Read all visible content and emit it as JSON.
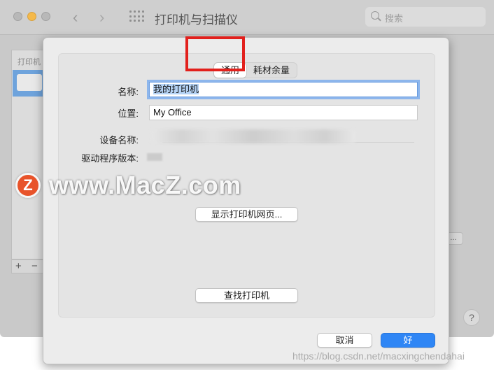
{
  "window": {
    "title": "打印机与扫描仪",
    "search_placeholder": "搜索"
  },
  "background": {
    "list_header": "打印机",
    "add_label": "+",
    "remove_label": "−",
    "options_button": "...",
    "help_label": "?"
  },
  "sheet": {
    "tabs": [
      {
        "label": "通用",
        "active": true
      },
      {
        "label": "耗材余量",
        "active": false
      }
    ],
    "fields": {
      "name_label": "名称:",
      "name_value": "我的打印机",
      "location_label": "位置:",
      "location_value": "My Office",
      "device_name_label": "设备名称:",
      "driver_version_label": "驱动程序版本:"
    },
    "buttons": {
      "show_webpage": "显示打印机网页...",
      "find_printer": "查找打印机",
      "cancel": "取消",
      "ok": "好"
    }
  },
  "watermark": {
    "logo_letter": "Z",
    "text": "www.MacZ.com",
    "url": "https://blog.csdn.net/macxingchendahai"
  },
  "colors": {
    "accent": "#2f86f5",
    "highlight_box": "#e2201c",
    "traffic_yellow": "#f5b94a"
  }
}
